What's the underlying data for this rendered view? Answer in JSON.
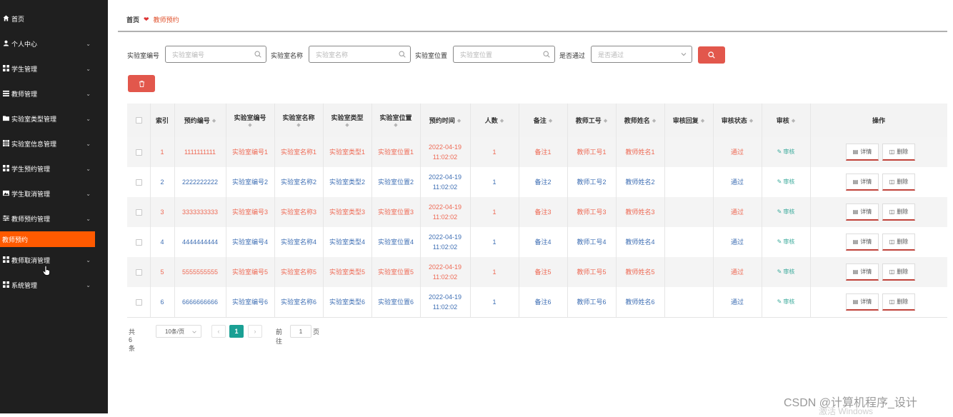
{
  "sidebar": {
    "items": [
      {
        "label": "首页",
        "icon": "home-icon",
        "chevron": false
      },
      {
        "label": "个人中心",
        "icon": "user-icon",
        "chevron": true
      },
      {
        "label": "学生管理",
        "icon": "grid-icon",
        "chevron": true
      },
      {
        "label": "教师管理",
        "icon": "list-icon",
        "chevron": true
      },
      {
        "label": "实验室类型管理",
        "icon": "folder-icon",
        "chevron": true
      },
      {
        "label": "实验室信息管理",
        "icon": "table-icon",
        "chevron": true
      },
      {
        "label": "学生预约管理",
        "icon": "grid-icon",
        "chevron": true
      },
      {
        "label": "学生取消管理",
        "icon": "image-icon",
        "chevron": true
      },
      {
        "label": "教师预约管理",
        "icon": "sliders-icon",
        "chevron": true
      },
      {
        "label": "教师取消管理",
        "icon": "grid-icon",
        "chevron": true
      },
      {
        "label": "系统管理",
        "icon": "grid-icon",
        "chevron": true
      }
    ],
    "active_sub": "教师预约"
  },
  "breadcrumb": {
    "home": "首页",
    "current": "教师预约"
  },
  "filters": {
    "lab_no": {
      "label": "实验室编号",
      "placeholder": "实验室编号"
    },
    "lab_name": {
      "label": "实验室名称",
      "placeholder": "实验室名称"
    },
    "lab_location": {
      "label": "实验室位置",
      "placeholder": "实验室位置"
    },
    "passed": {
      "label": "是否通过",
      "placeholder": "是否通过"
    }
  },
  "table": {
    "headers": {
      "index": "索引",
      "booking_no": "预约编号",
      "lab_no": "实验室编号",
      "lab_name": "实验室名称",
      "lab_type": "实验室类型",
      "lab_location": "实验室位置",
      "time": "预约时间",
      "people": "人数",
      "remark": "备注",
      "teacher_no": "教师工号",
      "teacher_name": "教师姓名",
      "reply": "审核回复",
      "status": "审核状态",
      "audit": "审核",
      "ops": "操作"
    },
    "audit_label": "审核",
    "detail_label": "详情",
    "delete_label": "删除",
    "rows": [
      {
        "index": "1",
        "booking_no": "1111111111",
        "lab_no": "实验室编号1",
        "lab_name": "实验室名称1",
        "lab_type": "实验室类型1",
        "lab_location": "实验室位置1",
        "date": "2022-04-19",
        "clock": "11:02:02",
        "people": "1",
        "remark": "备注1",
        "teacher_no": "教师工号1",
        "teacher_name": "教师姓名1",
        "reply": "",
        "status": "通过"
      },
      {
        "index": "2",
        "booking_no": "2222222222",
        "lab_no": "实验室编号2",
        "lab_name": "实验室名称2",
        "lab_type": "实验室类型2",
        "lab_location": "实验室位置2",
        "date": "2022-04-19",
        "clock": "11:02:02",
        "people": "1",
        "remark": "备注2",
        "teacher_no": "教师工号2",
        "teacher_name": "教师姓名2",
        "reply": "",
        "status": "通过"
      },
      {
        "index": "3",
        "booking_no": "3333333333",
        "lab_no": "实验室编号3",
        "lab_name": "实验室名称3",
        "lab_type": "实验室类型3",
        "lab_location": "实验室位置3",
        "date": "2022-04-19",
        "clock": "11:02:02",
        "people": "1",
        "remark": "备注3",
        "teacher_no": "教师工号3",
        "teacher_name": "教师姓名3",
        "reply": "",
        "status": "通过"
      },
      {
        "index": "4",
        "booking_no": "4444444444",
        "lab_no": "实验室编号4",
        "lab_name": "实验室名称4",
        "lab_type": "实验室类型4",
        "lab_location": "实验室位置4",
        "date": "2022-04-19",
        "clock": "11:02:02",
        "people": "1",
        "remark": "备注4",
        "teacher_no": "教师工号4",
        "teacher_name": "教师姓名4",
        "reply": "",
        "status": "通过"
      },
      {
        "index": "5",
        "booking_no": "5555555555",
        "lab_no": "实验室编号5",
        "lab_name": "实验室名称5",
        "lab_type": "实验室类型5",
        "lab_location": "实验室位置5",
        "date": "2022-04-19",
        "clock": "11:02:02",
        "people": "1",
        "remark": "备注5",
        "teacher_no": "教师工号5",
        "teacher_name": "教师姓名5",
        "reply": "",
        "status": "通过"
      },
      {
        "index": "6",
        "booking_no": "6666666666",
        "lab_no": "实验室编号6",
        "lab_name": "实验室名称6",
        "lab_type": "实验室类型6",
        "lab_location": "实验室位置6",
        "date": "2022-04-19",
        "clock": "11:02:02",
        "people": "1",
        "remark": "备注6",
        "teacher_no": "教师工号6",
        "teacher_name": "教师姓名6",
        "reply": "",
        "status": "通过"
      }
    ]
  },
  "pagination": {
    "total": "共 6 条",
    "page_size": "10条/页",
    "current_page": "1",
    "goto_label": "前往",
    "goto_value": "1",
    "page_suffix": "页"
  },
  "watermark": "CSDN @计算机程序_设计",
  "activate": "激活 Windows",
  "colors": {
    "accent": "#ff5a00",
    "danger": "#e2574c",
    "odd_text": "#ee6a55",
    "even_text": "#3f6fb4",
    "teal": "#1aa094"
  }
}
